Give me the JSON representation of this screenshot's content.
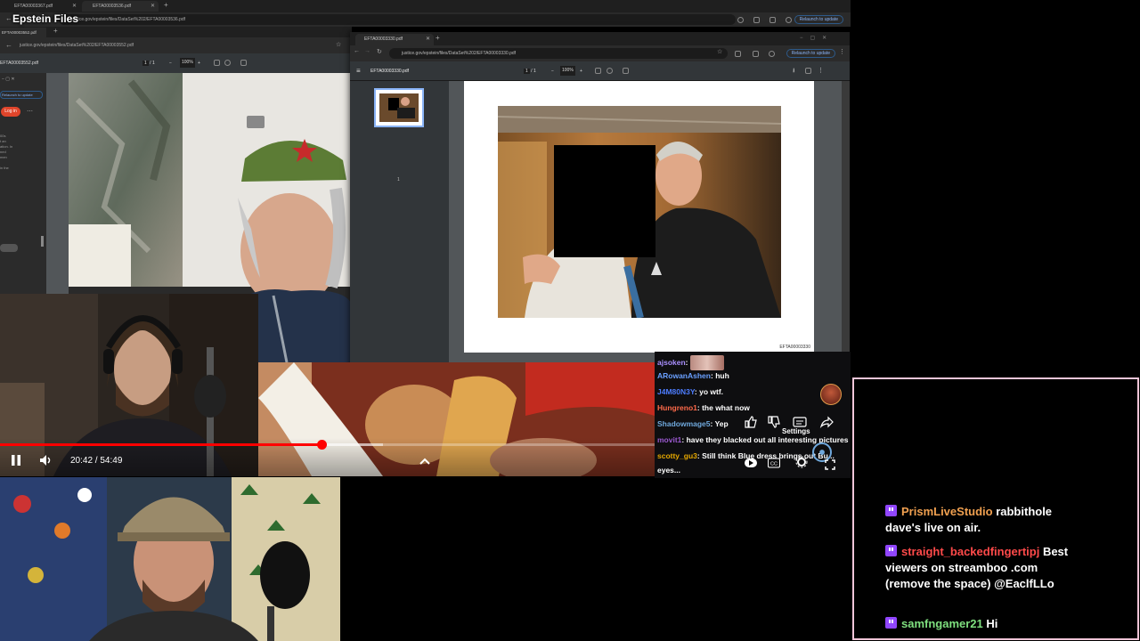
{
  "stream": {
    "title": "Epstein Files"
  },
  "back_browser": {
    "tabs": [
      {
        "label": "EFTA00003367.pdf"
      },
      {
        "label": "EFTA00003536.pdf"
      }
    ],
    "url": "justice.gov/epstein/files/DataSet%202/EFTA00003536.pdf",
    "relaunch_label": "Relaunch to update"
  },
  "left_pdf": {
    "tab_label": "EFTA00003552.pdf",
    "url": "justice.gov/epstein/files/DataSet%202/EFTA00003552.pdf",
    "filename": "EFTA00003552.pdf",
    "page_current": "1",
    "page_total": "1",
    "zoom": "100%",
    "relaunch_label": "Relaunch to update",
    "login_label": "Log in",
    "side_text": "00s\nt an\nation. In\nned\nmen\n\nin the"
  },
  "front_pdf": {
    "tab_label": "EFTA00003330.pdf",
    "url": "justice.gov/epstein/files/DataSet%202/EFTA00003330.pdf",
    "filename": "EFTA00003330.pdf",
    "page_current": "1",
    "page_total": "1",
    "zoom": "100%",
    "relaunch_label": "Relaunch to update",
    "thumb_number": "1",
    "page_id": "EFTA00003330"
  },
  "player": {
    "time": "20:42 / 54:49",
    "progress": 0.378,
    "settings_tooltip": "Settings"
  },
  "video_chat": [
    {
      "user": "ajsoken",
      "color": "#a98fff",
      "text": "",
      "emote": true
    },
    {
      "user": "ARowanAshen",
      "color": "#6aa0ff",
      "text": "huh"
    },
    {
      "user": "J4M80N3Y",
      "color": "#4d7dff",
      "text": "yo wtf."
    },
    {
      "user": "Hungreno1",
      "color": "#ff6a4a",
      "text": "the what now"
    },
    {
      "user": "Shadowmage5",
      "color": "#6fa8dc",
      "text": "Yep"
    },
    {
      "user": "movit1",
      "color": "#9b59d0",
      "text": "have they blacked out all interesting pictures"
    },
    {
      "user": "scotty_gu3",
      "color": "#e6a800",
      "text": "Still think Blue dress brings out Bu..."
    },
    {
      "user": "",
      "color": "#ffffff",
      "text": "eyes..."
    }
  ],
  "chat": [
    {
      "user": "PrismLiveStudio",
      "user_color": "#f0a050",
      "text": "rabbithole dave's live on air."
    },
    {
      "user": "straight_backedfingertipj",
      "user_color": "#ff4a4a",
      "text": "Best viewers on streamboo .com (remove the space) @EaclfLLo"
    },
    {
      "user": "samfngamer21",
      "user_color": "#7fe07f",
      "text": "Hi"
    }
  ],
  "colors": {
    "progress": "#ff0000",
    "chat_border": "#f2c6d9",
    "twitch_badge": "#9146ff",
    "accent_blue": "#8ab4f8"
  },
  "icons": [
    "play-pause-icon",
    "volume-icon",
    "chevron-up-icon",
    "thumbs-up-icon",
    "thumbs-down-icon",
    "captions-icon",
    "share-icon",
    "settings-icon",
    "fullscreen-icon",
    "twitch-badge-icon",
    "back-arrow-icon",
    "reload-icon",
    "star-icon",
    "menu-icon"
  ]
}
